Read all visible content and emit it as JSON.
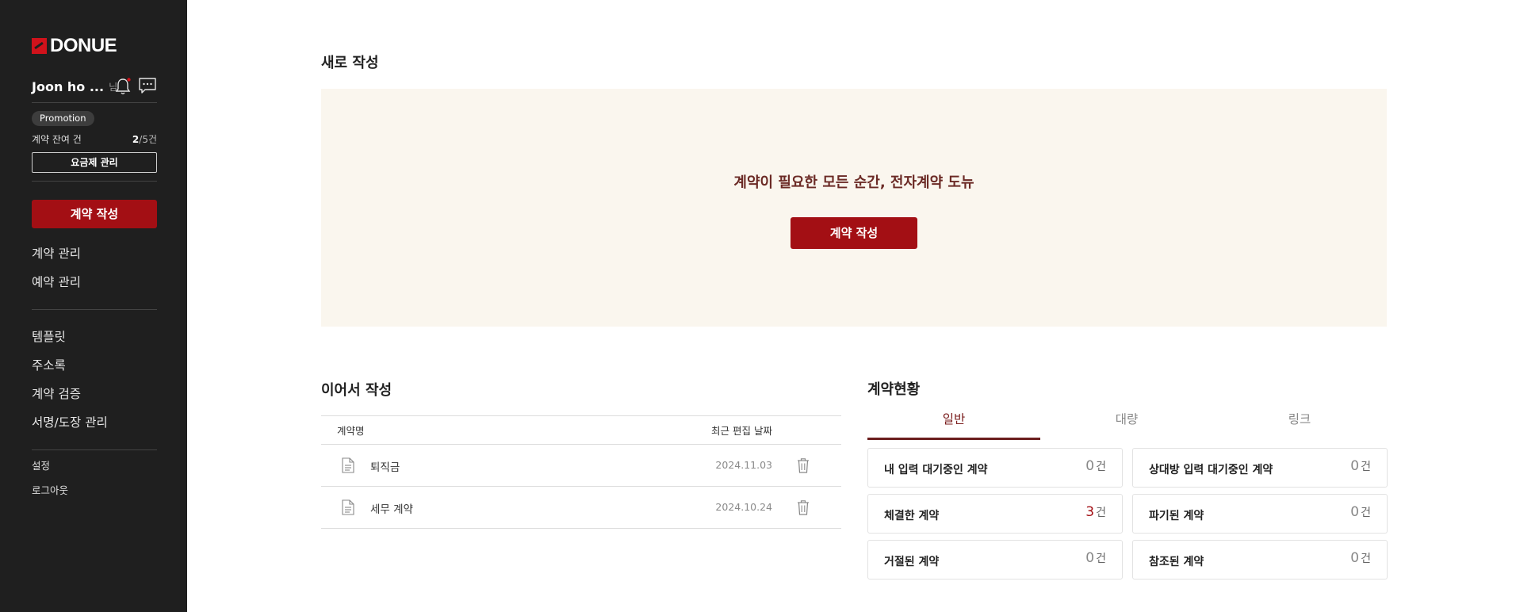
{
  "brand": {
    "name": "DONUE"
  },
  "user": {
    "name": "Joon ho ...",
    "suffix": "님"
  },
  "plan": {
    "badge": "Promotion",
    "remaining_label": "계약 잔여 건",
    "remaining_used": "2",
    "remaining_total": "/5건",
    "manage_label": "요금제 관리"
  },
  "sidebar": {
    "create_label": "계약 작성",
    "nav_primary": [
      {
        "label": "계약 관리"
      },
      {
        "label": "예약 관리"
      }
    ],
    "nav_secondary": [
      {
        "label": "템플릿"
      },
      {
        "label": "주소록"
      },
      {
        "label": "계약 검증"
      },
      {
        "label": "서명/도장 관리"
      }
    ],
    "nav_footer": [
      {
        "label": "설정"
      },
      {
        "label": "로그아웃"
      }
    ]
  },
  "new_section": {
    "title": "새로 작성",
    "headline": "계약이 필요한 모든 순간, 전자계약 도뉴",
    "button_label": "계약 작성"
  },
  "continue_section": {
    "title": "이어서 작성",
    "col_name": "계약명",
    "col_date": "최근 편집 날짜",
    "rows": [
      {
        "name": "퇴직금",
        "date": "2024.11.03"
      },
      {
        "name": "세무 계약",
        "date": "2024.10.24"
      }
    ]
  },
  "status_section": {
    "title": "계약현황",
    "tabs": [
      {
        "label": "일반"
      },
      {
        "label": "대량"
      },
      {
        "label": "링크"
      }
    ],
    "active_tab": "일반",
    "unit": "건",
    "cards": [
      {
        "label": "내 입력 대기중인 계약",
        "count": "0"
      },
      {
        "label": "상대방 입력 대기중인 계약",
        "count": "0"
      },
      {
        "label": "체결한 계약",
        "count": "3"
      },
      {
        "label": "파기된 계약",
        "count": "0"
      },
      {
        "label": "거절된 계약",
        "count": "0"
      },
      {
        "label": "참조된 계약",
        "count": "0"
      }
    ]
  },
  "colors": {
    "sidebar_bg": "#1f1f1f",
    "accent": "#a30f14",
    "hero_bg": "#faf6ee",
    "headline": "#6b2a25",
    "notification_dot": "#d0121b"
  }
}
